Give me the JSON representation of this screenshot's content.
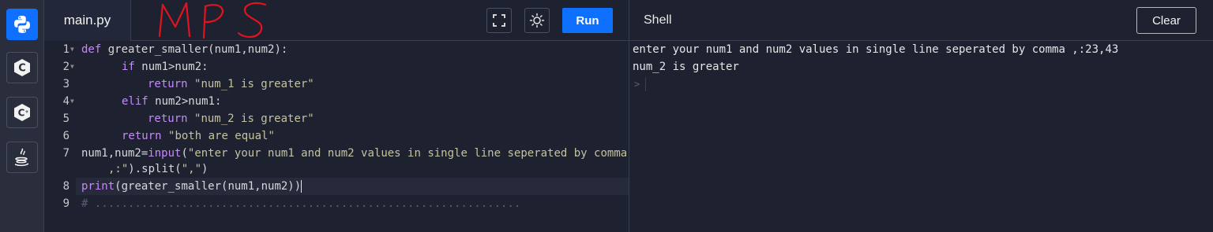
{
  "sidebar": {
    "items": [
      {
        "name": "python-icon",
        "active": true
      },
      {
        "name": "c-icon",
        "active": false
      },
      {
        "name": "cpp-icon",
        "active": false
      },
      {
        "name": "java-icon",
        "active": false
      }
    ]
  },
  "editor": {
    "tab_label": "main.py",
    "annotation": "MPS",
    "run_label": "Run",
    "lines": [
      {
        "num": "1",
        "fold": true
      },
      {
        "num": "2",
        "fold": true
      },
      {
        "num": "3",
        "fold": false
      },
      {
        "num": "4",
        "fold": true
      },
      {
        "num": "5",
        "fold": false
      },
      {
        "num": "6",
        "fold": false
      },
      {
        "num": "7",
        "fold": false
      },
      {
        "num": "",
        "fold": false
      },
      {
        "num": "8",
        "fold": false
      },
      {
        "num": "9",
        "fold": false
      }
    ],
    "code": {
      "l1_kw": "def",
      "l1_rest": " greater_smaller(num1,num2):",
      "l2_kw": "if",
      "l2_rest": " num1>num2:",
      "l3_kw": "return",
      "l3_str": "\"num_1 is greater\"",
      "l4_kw": "elif",
      "l4_rest": " num2>num1:",
      "l5_kw": "return",
      "l5_str": "\"num_2 is greater\"",
      "l6_kw": "return",
      "l6_str": "\"both are equal\"",
      "l7_a": "num1,num2=",
      "l7_fn": "input",
      "l7_b": "(",
      "l7_str": "\"enter your num1 and num2 values in single line seperated by comma",
      "l7c_str": ",:\"",
      "l7c_rest": ").split(",
      "l7c_str2": "\",\"",
      "l7c_end": ")",
      "l8_fn": "print",
      "l8_rest": "(greater_smaller(num1,num2))",
      "l9_cmt": "# ................................................................"
    }
  },
  "shell": {
    "title": "Shell",
    "clear_label": "Clear",
    "output": [
      "enter your num1 and num2 values in single line seperated by comma ,:23,43",
      "num_2 is greater"
    ],
    "prompt": ">"
  },
  "colors": {
    "accent": "#0f6fff",
    "background": "#1e2130",
    "keyword": "#c58af9",
    "string": "#c3c3a0",
    "annotation": "#e0141e"
  }
}
